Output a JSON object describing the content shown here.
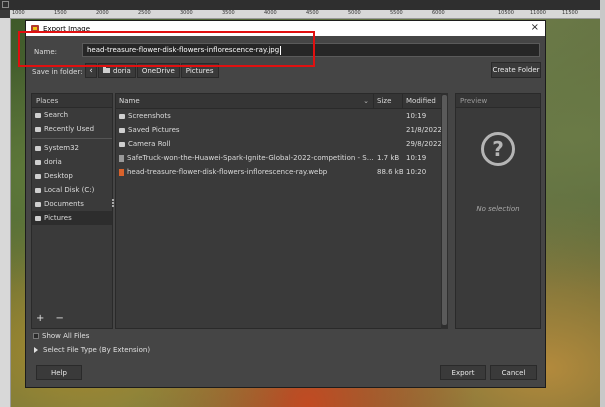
{
  "background": {
    "ruler_numbers": [
      "1000",
      "1500",
      "2000",
      "2500",
      "3000",
      "3500",
      "4000",
      "4500",
      "5000",
      "5500",
      "6000",
      "10500",
      "11000",
      "11500"
    ]
  },
  "dialog": {
    "title": "Export Image",
    "close_glyph": "×",
    "name_label": "Name:",
    "name_value": "head-treasure-flower-disk-flowers-inflorescence-ray.jpg",
    "save_in_folder_label": "Save in folder:",
    "back_glyph": "‹",
    "breadcrumbs": [
      "doria",
      "OneDrive",
      "Pictures"
    ],
    "create_folder_label": "Create Folder",
    "places": {
      "header": "Places",
      "items": [
        {
          "label": "Search",
          "icon": "search-icon"
        },
        {
          "label": "Recently Used",
          "icon": "recent-icon"
        },
        {
          "label": "System32",
          "icon": "folder-icon"
        },
        {
          "label": "doria",
          "icon": "home-folder-icon"
        },
        {
          "label": "Desktop",
          "icon": "desktop-icon"
        },
        {
          "label": "Local Disk (C:)",
          "icon": "drive-icon"
        },
        {
          "label": "Documents",
          "icon": "folder-icon"
        },
        {
          "label": "Pictures",
          "icon": "folder-icon"
        }
      ],
      "add_remove": "+ −"
    },
    "files": {
      "columns": [
        "Name",
        "Size",
        "Modified"
      ],
      "sort_glyph": "⌄",
      "rows": [
        {
          "name": "Screenshots",
          "size": "",
          "modified": "10:19",
          "icon": "folder-icon"
        },
        {
          "name": "Saved Pictures",
          "size": "",
          "modified": "21/8/2022",
          "icon": "folder-icon"
        },
        {
          "name": "Camera Roll",
          "size": "",
          "modified": "29/8/2022",
          "icon": "folder-icon"
        },
        {
          "name": "SafeTruck-won-the-Huawei-Spark-Ignite-Global-2022-competition - Shortcut.l...",
          "size": "1.7 kB",
          "modified": "10:19",
          "icon": "shortcut-file-icon"
        },
        {
          "name": "head-treasure-flower-disk-flowers-inflorescence-ray.webp",
          "size": "88.6 kB",
          "modified": "10:20",
          "icon": "image-file-icon"
        }
      ]
    },
    "preview": {
      "header": "Preview",
      "icon_glyph": "?",
      "no_selection": "No selection"
    },
    "show_all_files": "Show All Files",
    "select_file_type": "Select File Type (By Extension)",
    "help_label": "Help",
    "export_label": "Export",
    "cancel_label": "Cancel"
  },
  "colors": {
    "highlight": "#e01010",
    "dialog_bg": "#454545",
    "panel_bg": "#3a3a3a"
  }
}
